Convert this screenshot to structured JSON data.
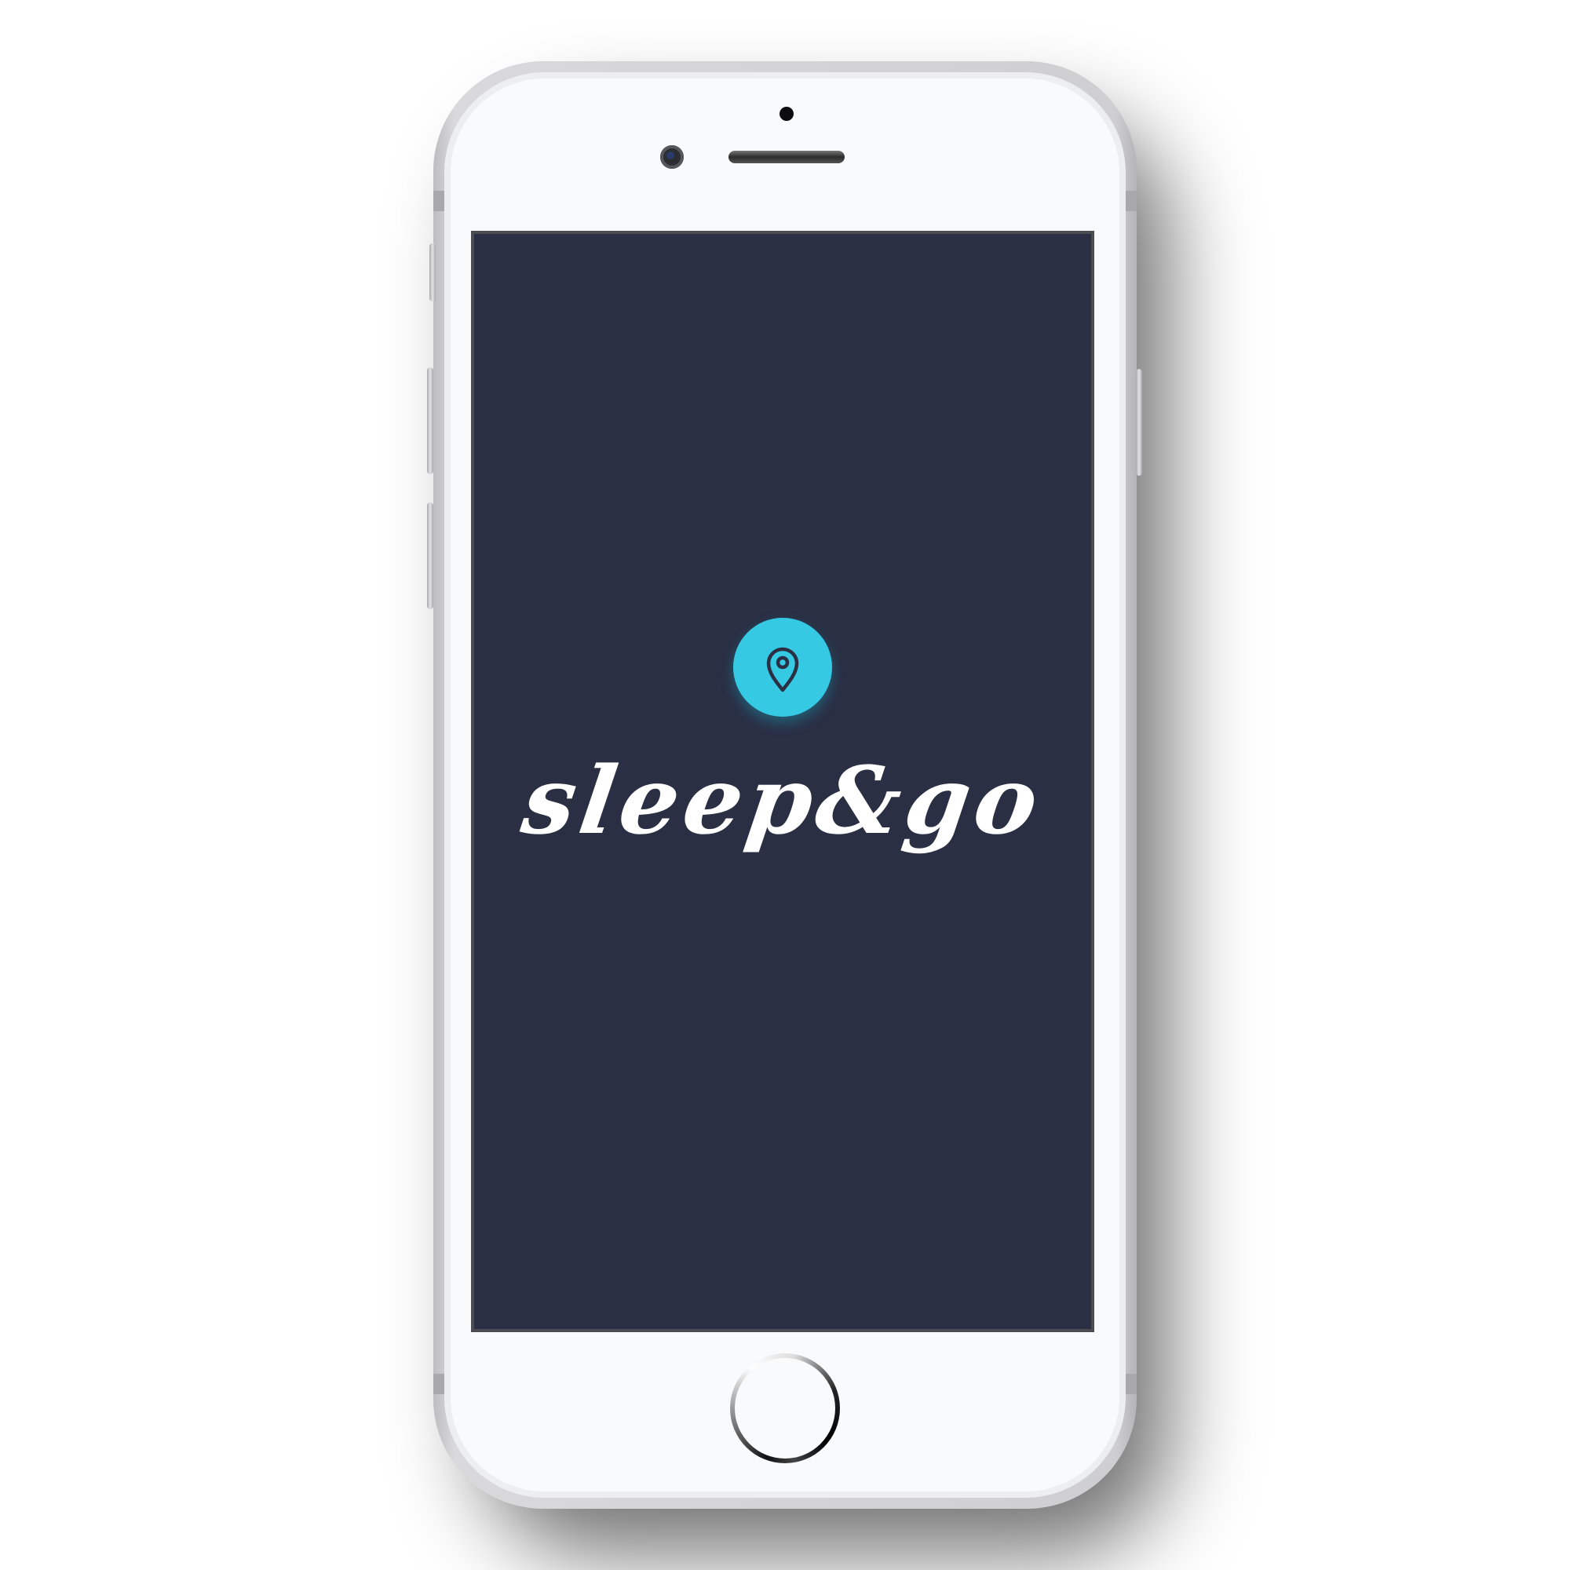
{
  "app": {
    "wordmark": "sleep&go",
    "logo_icon": "map-pin-icon"
  },
  "colors": {
    "screen_background": "#2a2f44",
    "logo_accent": "#36c9e3",
    "wordmark_color": "#ffffff",
    "device_body": "#f9fafc"
  }
}
